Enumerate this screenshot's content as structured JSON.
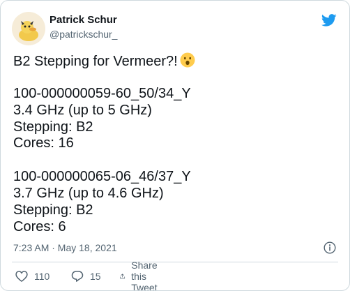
{
  "author": {
    "display_name": "Patrick Schur",
    "handle": "@patrickschur_"
  },
  "icons": {
    "platform_logo": "twitter-bird-icon",
    "emoji": "hushed-face-emoji",
    "info": "info-icon",
    "like": "heart-icon",
    "reply": "reply-bubble-icon",
    "share": "share-upload-icon"
  },
  "tweet": {
    "headline": "B2 Stepping for Vermeer?!",
    "block1": {
      "part": "100-000000059-60_50/34_Y",
      "clock": "3.4 GHz (up to 5 GHz)",
      "stepping": "Stepping: B2",
      "cores": "Cores: 16"
    },
    "block2": {
      "part": "100-000000065-06_46/37_Y",
      "clock": "3.7 GHz (up to 4.6 GHz)",
      "stepping": "Stepping: B2",
      "cores": "Cores: 6"
    },
    "timestamp": "7:23 AM · May 18, 2021"
  },
  "actions": {
    "likes": "110",
    "replies": "15",
    "share_label": "Share this Tweet"
  },
  "colors": {
    "twitter_blue": "#1d9bf0",
    "text_primary": "#0f1419",
    "text_secondary": "#536471",
    "border": "#cfd9de"
  }
}
